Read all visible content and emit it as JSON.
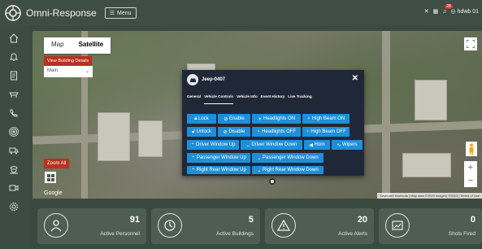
{
  "app": {
    "title": "Omni-Response",
    "menu_label": "Menu",
    "user": "hdwb 01",
    "notification_count": "28"
  },
  "sidebar": {
    "icons": [
      "home-icon",
      "bell-icon",
      "document-icon",
      "truck-icon",
      "phone-icon",
      "broadcast-icon",
      "vehicle-icon",
      "police-icon",
      "camera-icon",
      "settings-icon"
    ]
  },
  "map": {
    "map_label": "Map",
    "satellite_label": "Satellite",
    "view_building_label": "View Building Details",
    "main_select": "Main",
    "zoom_all_label": "Zoom All",
    "google_label": "Google",
    "attribution": "Keyboard shortcuts | Map data ©2023 Imagery ©2023 | Terms of Use"
  },
  "popup": {
    "title": "Jeep-0407",
    "tabs": [
      "General",
      "Vehicle Controls",
      "Vehicle Info",
      "Event History",
      "Live Tracking"
    ],
    "active_tab": "Vehicle Controls",
    "controls": {
      "lock": "Lock",
      "enable": "Enable",
      "headlights_on": "Headlights ON",
      "high_beam_on": "High Beam ON",
      "unlock": "Unlock",
      "disable": "Disable",
      "headlights_off": "Headlights OFF",
      "high_beam_off": "High Beam OFF",
      "driver_up": "Driver Window Up",
      "driver_down": "Driver Window Down",
      "horn": "Horn",
      "wipers": "Wipers",
      "passenger_up": "Passenger Window Up",
      "passenger_down": "Passenger Window Down",
      "right_rear_up": "Right Rear Window Up",
      "right_rear_down": "Right Rear Window Down"
    }
  },
  "stats": [
    {
      "value": "91",
      "label": "Active Personnel",
      "icon": "person-icon"
    },
    {
      "value": "5",
      "label": "Active Buildings",
      "icon": "clock-icon"
    },
    {
      "value": "20",
      "label": "Active Alerts",
      "icon": "alert-icon"
    },
    {
      "value": "0",
      "label": "Shots Fired",
      "icon": "chart-icon"
    }
  ],
  "colors": {
    "accent": "#1f8fd8",
    "danger": "#b8321f",
    "bg": "#3b4a40"
  }
}
